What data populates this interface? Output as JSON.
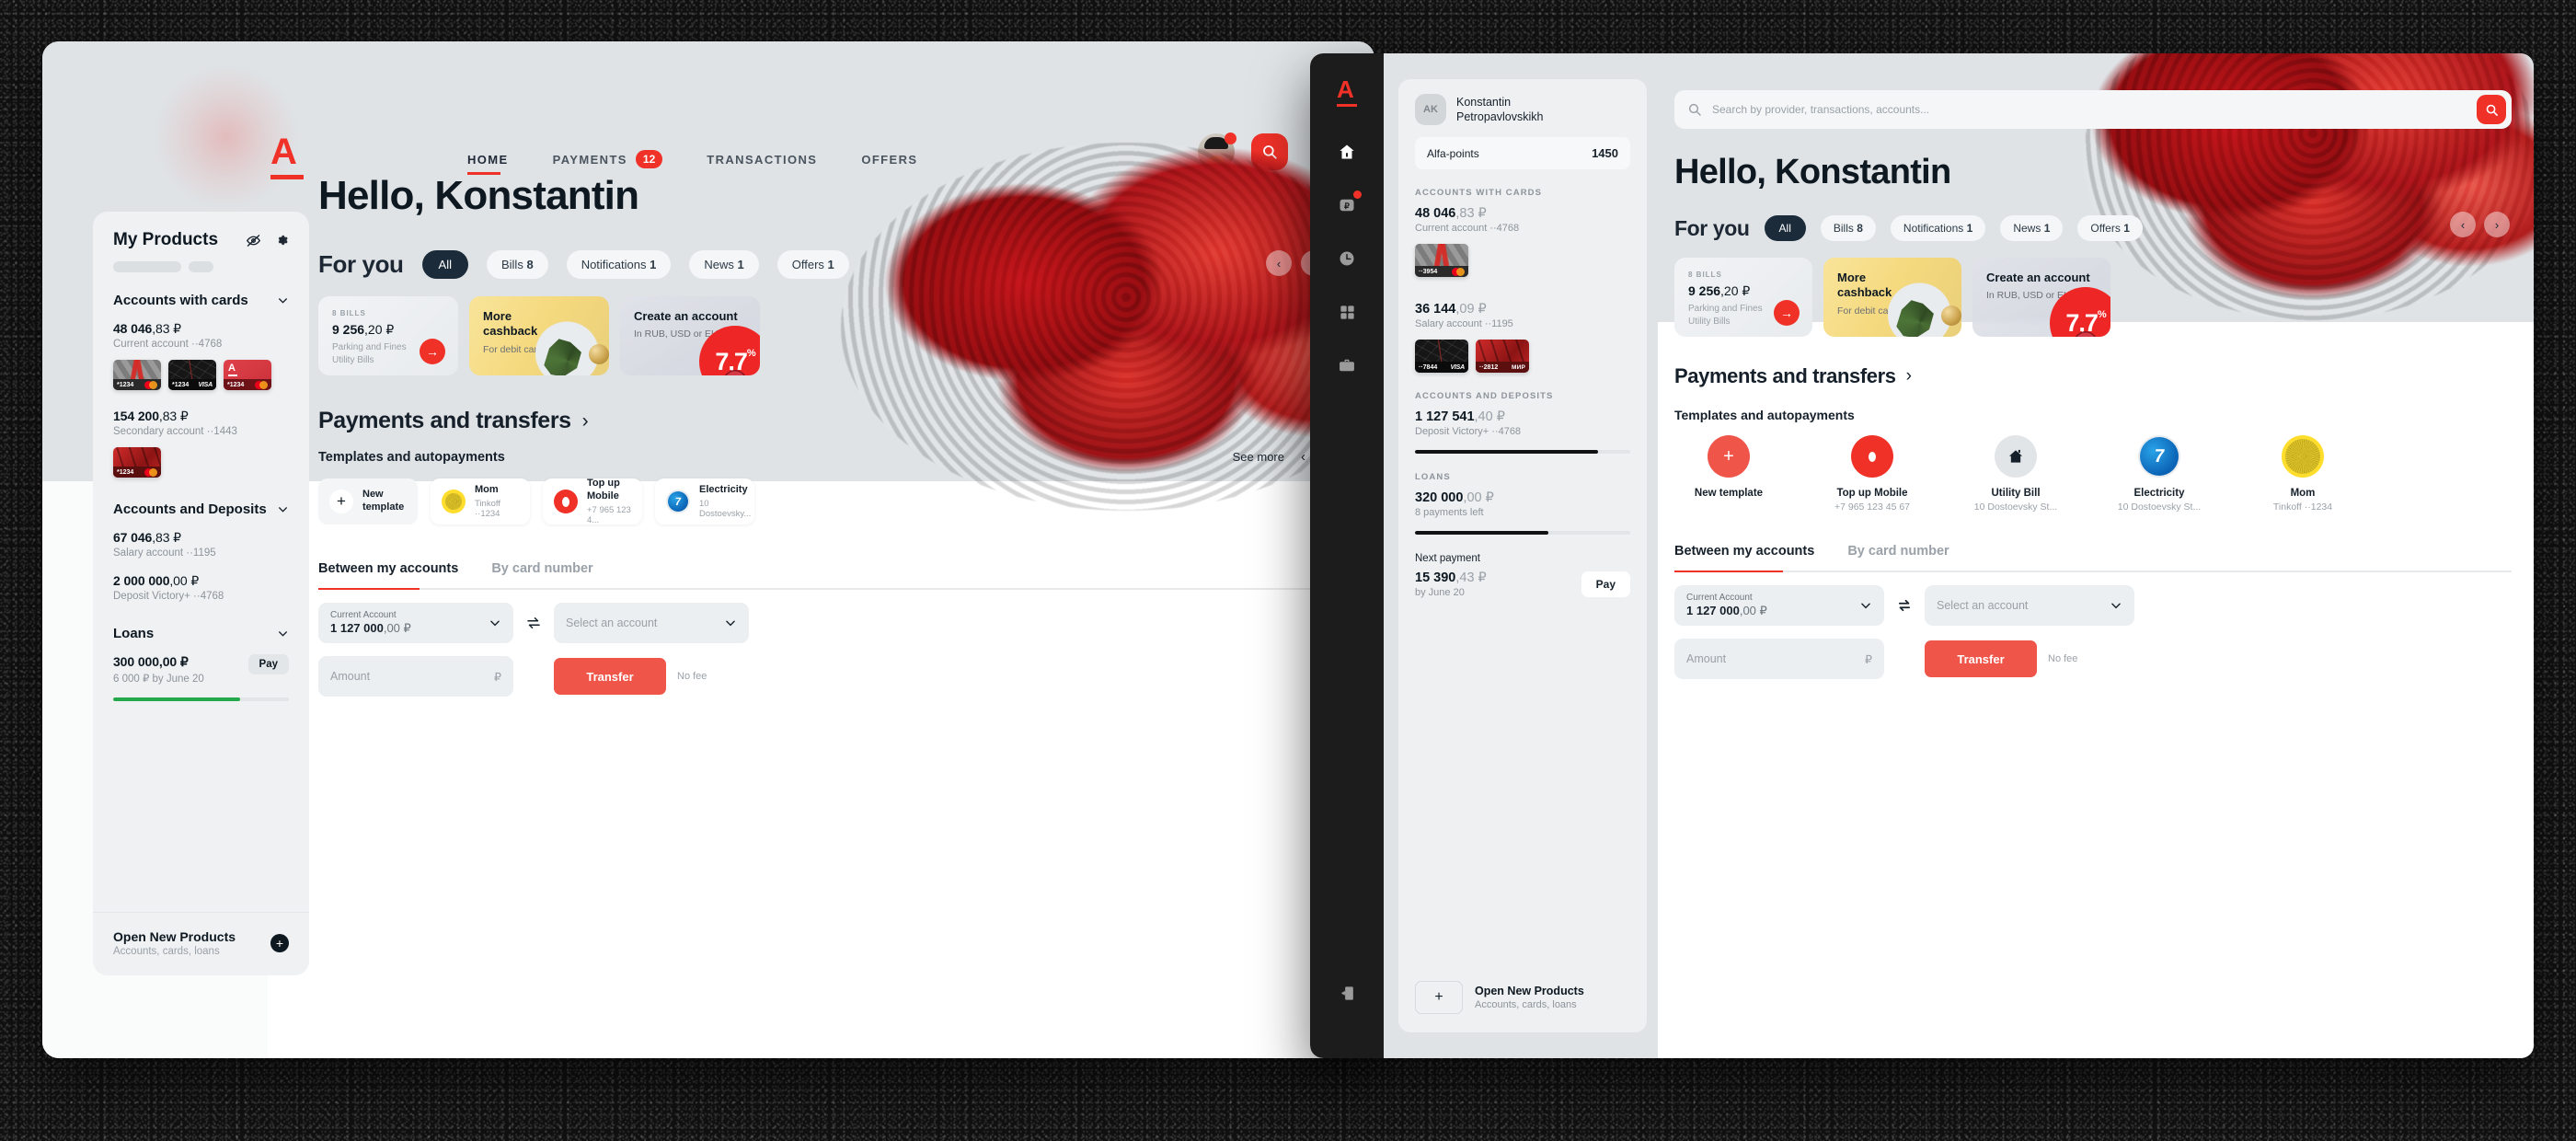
{
  "brand": {
    "logo_letter": "A",
    "accent": "#ef3128",
    "dark": "#1c2b3a"
  },
  "window1": {
    "nav": [
      {
        "label": "HOME",
        "badge": null,
        "active": true
      },
      {
        "label": "PAYMENTS",
        "badge": "12",
        "active": false
      },
      {
        "label": "TRANSACTIONS",
        "badge": null,
        "active": false
      },
      {
        "label": "OFFERS",
        "badge": null,
        "active": false
      }
    ],
    "sidebar": {
      "title": "My Products",
      "sections": [
        {
          "title": "Accounts with cards"
        },
        {
          "title": "Accounts and Deposits"
        },
        {
          "title": "Loans"
        }
      ],
      "accounts_with_cards": [
        {
          "amount_int": "48 046",
          "amount_frac": ",83 ₽",
          "subtitle": "Current account ··4768",
          "cards": [
            {
              "last4": "*1234",
              "scheme": "mastercard",
              "style": "grey"
            },
            {
              "last4": "*1234",
              "scheme": "VISA",
              "style": "black"
            },
            {
              "last4": "*1234",
              "scheme": "mastercard",
              "style": "red"
            }
          ]
        },
        {
          "amount_int": "154 200",
          "amount_frac": ",83 ₽",
          "subtitle": "Secondary account ··1443",
          "cards": [
            {
              "last4": "*1234",
              "scheme": "mastercard",
              "style": "redsilk"
            }
          ]
        }
      ],
      "deposits": [
        {
          "amount_int": "67 046",
          "amount_frac": ",83 ₽",
          "subtitle": "Salary account ··1195"
        },
        {
          "amount_int": "2 000 000",
          "amount_frac": ",00 ₽",
          "subtitle": "Deposit Victory+ ··4768"
        }
      ],
      "loans": [
        {
          "amount": "300 000,00 ₽",
          "subtitle": "6 000 ₽ by June 20",
          "pay_label": "Pay",
          "progress_pct": 72
        }
      ],
      "open_new": {
        "title": "Open New Products",
        "subtitle": "Accounts, cards, loans",
        "plus": "+"
      }
    },
    "greeting": "Hello, Konstantin",
    "for_you": {
      "title": "For you",
      "chips": [
        {
          "label": "All",
          "count": "",
          "active": true
        },
        {
          "label": "Bills",
          "count": "8",
          "active": false
        },
        {
          "label": "Notifications",
          "count": "1",
          "active": false
        },
        {
          "label": "News",
          "count": "1",
          "active": false
        },
        {
          "label": "Offers",
          "count": "1",
          "active": false
        }
      ],
      "cards": [
        {
          "kind": "bills",
          "label": "8 BILLS",
          "amount_int": "9 256",
          "amount_frac": ",20 ₽",
          "sub_line1": "Parking and Fines",
          "sub_line2": "Utility Bills",
          "arrow": "→"
        },
        {
          "kind": "cashback",
          "title_line1": "More",
          "title_line2": "cashback",
          "subtitle": "For debit card"
        },
        {
          "kind": "create",
          "title": "Create an account",
          "subtitle": "In RUB, USD or EUR",
          "rate": "7,7",
          "rate_suffix": "%"
        }
      ]
    },
    "payments": {
      "title": "Payments and transfers",
      "chevron": "›",
      "templates_title": "Templates and autopayments",
      "see_more": "See more",
      "templates": [
        {
          "title": "New",
          "title2": "template",
          "subtitle": "",
          "icon": "plus"
        },
        {
          "title": "Mom",
          "subtitle": "Tinkoff ··1234",
          "icon": "tinkoff"
        },
        {
          "title": "Top up Mobile",
          "subtitle": "+7 965 123 4...",
          "icon": "mts"
        },
        {
          "title": "Electricity",
          "subtitle": "10 Dostoevsky...",
          "icon": "electricity"
        }
      ]
    },
    "transfer": {
      "tabs": [
        {
          "label": "Between my accounts",
          "active": true
        },
        {
          "label": "By card number",
          "active": false
        }
      ],
      "from": {
        "label": "Current Account",
        "amount_int": "1 127 000",
        "amount_frac": ",00 ₽"
      },
      "to_placeholder": "Select an account",
      "amount_placeholder": "Amount",
      "currency": "₽",
      "swap_icon": "⇄",
      "button": "Transfer",
      "fee_note": "No fee"
    }
  },
  "window2": {
    "rail": {
      "logo_letter": "A",
      "items": [
        {
          "name": "home",
          "badge": false
        },
        {
          "name": "payments",
          "badge": true
        },
        {
          "name": "history",
          "badge": false
        },
        {
          "name": "apps",
          "badge": false
        },
        {
          "name": "briefcase",
          "badge": false
        }
      ],
      "bottom": {
        "name": "exit"
      }
    },
    "panel": {
      "user": {
        "initials": "AK",
        "name_line1": "Konstantin",
        "name_line2": "Petropavlovskikh"
      },
      "points": {
        "label": "Alfa-points",
        "value": "1450"
      },
      "sections": [
        {
          "title": "ACCOUNTS WITH CARDS",
          "items": [
            {
              "amount_int": "48 046",
              "amount_frac": ",83 ₽",
              "subtitle": "Current account ··4768",
              "cards": [
                {
                  "last4": "··3954",
                  "scheme": "mastercard",
                  "style": "grey"
                }
              ]
            },
            {
              "amount_int": "36 144",
              "amount_frac": ",09 ₽",
              "subtitle": "Salary account ··1195",
              "cards": [
                {
                  "last4": "··7844",
                  "scheme": "VISA",
                  "style": "black"
                },
                {
                  "last4": "··2812",
                  "scheme": "МИР",
                  "style": "redsilk"
                }
              ]
            }
          ]
        },
        {
          "title": "ACCOUNTS AND DEPOSITS",
          "items": [
            {
              "amount_int": "1 127 541",
              "amount_frac": ",40 ₽",
              "subtitle": "Deposit Victory+ ··4768",
              "progress_pct": 85
            }
          ]
        },
        {
          "title": "LOANS",
          "items": [
            {
              "amount_int": "320 000",
              "amount_frac": ",00 ₽",
              "subtitle": "8 payments left",
              "progress_pct": 62
            }
          ]
        }
      ],
      "next_payment": {
        "label": "Next payment",
        "amount_int": "15 390",
        "amount_frac": ",43 ₽",
        "due": "by June 20",
        "pay_label": "Pay"
      },
      "open_new": {
        "title": "Open New Products",
        "subtitle": "Accounts, cards, loans",
        "plus": "+"
      }
    },
    "search": {
      "placeholder": "Search by provider, transactions, accounts..."
    },
    "greeting": "Hello, Konstantin",
    "for_you": {
      "title": "For you",
      "chips": [
        {
          "label": "All",
          "count": "",
          "active": true
        },
        {
          "label": "Bills",
          "count": "8",
          "active": false
        },
        {
          "label": "Notifications",
          "count": "1",
          "active": false
        },
        {
          "label": "News",
          "count": "1",
          "active": false
        },
        {
          "label": "Offers",
          "count": "1",
          "active": false
        }
      ],
      "cards": [
        {
          "kind": "bills",
          "label": "8 BILLS",
          "amount_int": "9 256",
          "amount_frac": ",20 ₽",
          "sub_line1": "Parking and Fines",
          "sub_line2": "Utility Bills",
          "arrow": "→"
        },
        {
          "kind": "cashback",
          "title_line1": "More",
          "title_line2": "cashback",
          "subtitle": "For debit card"
        },
        {
          "kind": "create",
          "title": "Create an account",
          "subtitle": "In RUB, USD or EUR",
          "rate": "7,7",
          "rate_suffix": "%"
        }
      ]
    },
    "payments": {
      "title": "Payments and transfers",
      "chevron": "›",
      "templates_title": "Templates and autopayments",
      "templates": [
        {
          "title": "New template",
          "subtitle": "",
          "icon": "plus"
        },
        {
          "title": "Top up Mobile",
          "subtitle": "+7 965 123 45 67",
          "icon": "mts"
        },
        {
          "title": "Utility Bill",
          "subtitle": "10 Dostoevsky St...",
          "icon": "utility"
        },
        {
          "title": "Electricity",
          "subtitle": "10 Dostoevsky St...",
          "icon": "electricity"
        },
        {
          "title": "Mom",
          "subtitle": "Tinkoff ··1234",
          "icon": "tinkoff"
        }
      ]
    },
    "transfer": {
      "tabs": [
        {
          "label": "Between my accounts",
          "active": true
        },
        {
          "label": "By card number",
          "active": false
        }
      ],
      "from": {
        "label": "Current Account",
        "amount_int": "1 127 000",
        "amount_frac": ",00 ₽"
      },
      "to_placeholder": "Select an account",
      "amount_placeholder": "Amount",
      "currency": "₽",
      "swap_icon": "⇄",
      "button": "Transfer",
      "fee_note": "No fee"
    }
  }
}
